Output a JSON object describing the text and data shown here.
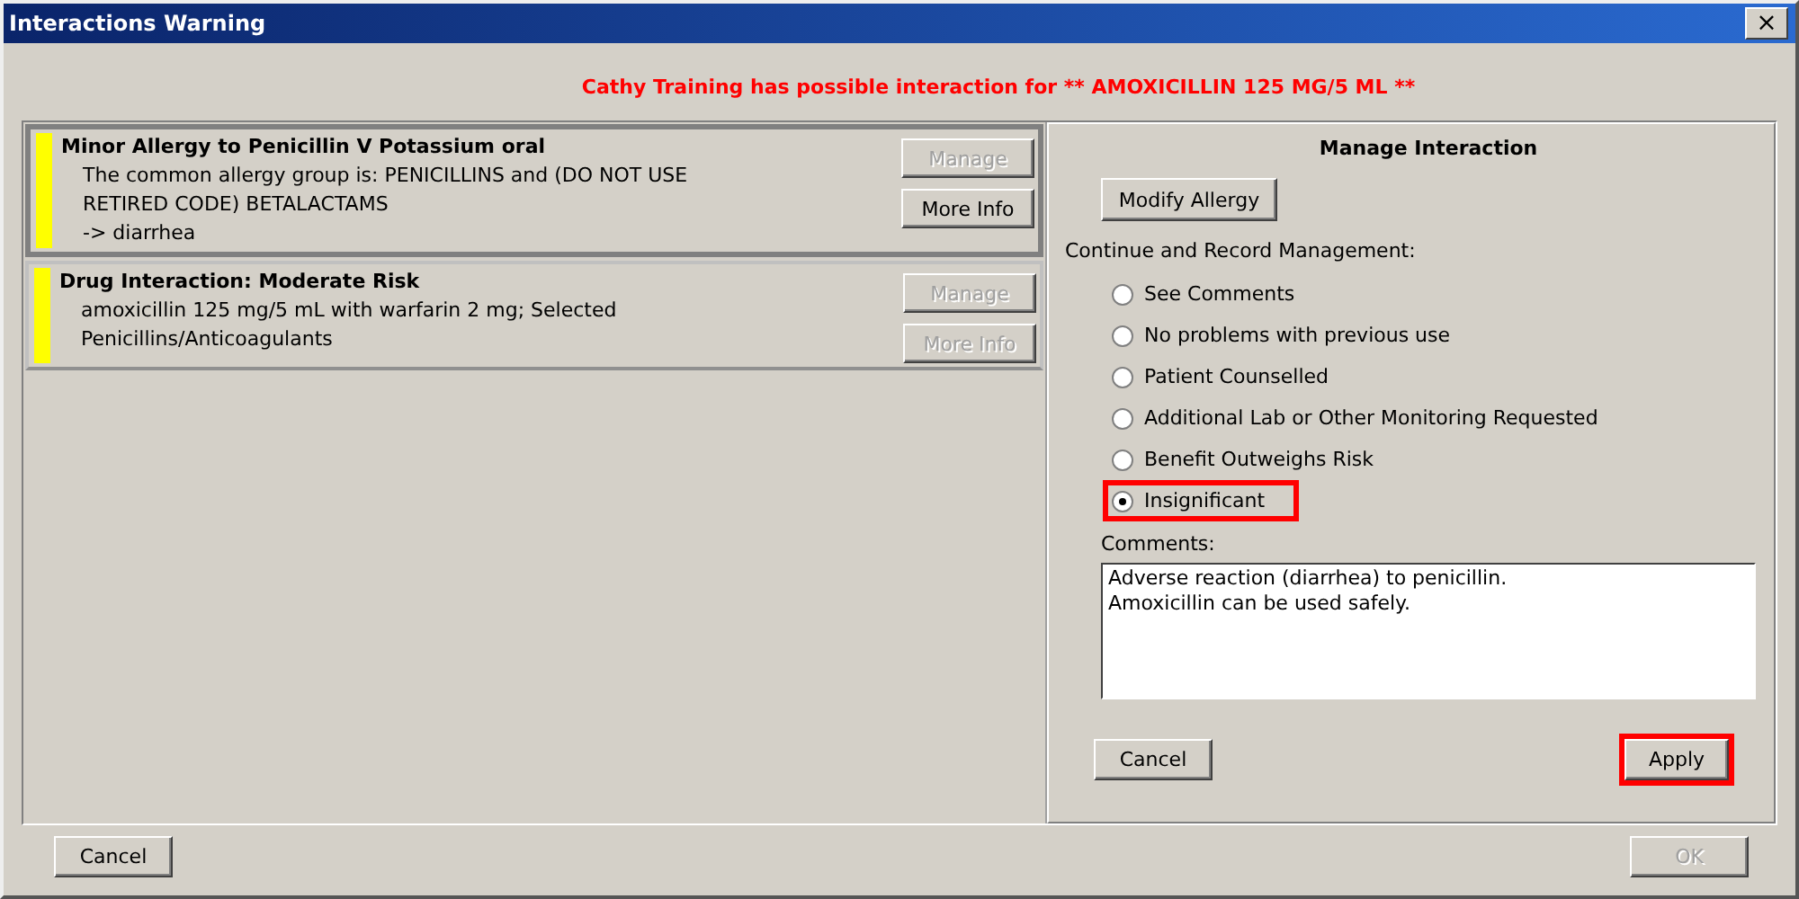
{
  "window": {
    "title": "Interactions Warning",
    "close": "×"
  },
  "warning": "Cathy Training has possible interaction for ** AMOXICILLIN 125 MG/5 ML **",
  "alerts": [
    {
      "title": "Minor Allergy to Penicillin V Potassium oral",
      "lines": [
        "The common allergy group is: PENICILLINS and (DO NOT USE",
        "RETIRED CODE) BETALACTAMS",
        "-> diarrhea"
      ],
      "color": "#ffff00",
      "selected": true,
      "buttons": [
        {
          "label": "Manage",
          "disabled": true
        },
        {
          "label": "More Info",
          "disabled": false
        }
      ]
    },
    {
      "title": "Drug Interaction: Moderate Risk",
      "lines": [
        "amoxicillin 125 mg/5 mL with warfarin 2 mg; Selected",
        "Penicillins/Anticoagulants"
      ],
      "color": "#ffff00",
      "selected": false,
      "buttons": [
        {
          "label": "Manage",
          "disabled": true
        },
        {
          "label": "More Info",
          "disabled": true
        }
      ]
    }
  ],
  "manage": {
    "title": "Manage Interaction",
    "modify_button": "Modify Allergy",
    "section_label": "Continue and Record Management:",
    "options": [
      {
        "label": "See Comments",
        "selected": false,
        "highlighted": false
      },
      {
        "label": "No problems with previous use",
        "selected": false,
        "highlighted": false
      },
      {
        "label": "Patient Counselled",
        "selected": false,
        "highlighted": false
      },
      {
        "label": "Additional Lab or Other Monitoring Requested",
        "selected": false,
        "highlighted": false
      },
      {
        "label": "Benefit Outweighs Risk",
        "selected": false,
        "highlighted": false
      },
      {
        "label": "Insignificant",
        "selected": true,
        "highlighted": true
      }
    ],
    "comments_label": "Comments:",
    "comments": "Adverse reaction (diarrhea) to penicillin.\nAmoxicillin can be used safely.",
    "cancel": {
      "label": "Cancel",
      "disabled": false,
      "highlighted": false
    },
    "apply": {
      "label": "Apply",
      "disabled": false,
      "highlighted": true
    }
  },
  "footer": {
    "cancel": {
      "label": "Cancel",
      "disabled": false
    },
    "ok": {
      "label": "OK",
      "disabled": true
    }
  }
}
